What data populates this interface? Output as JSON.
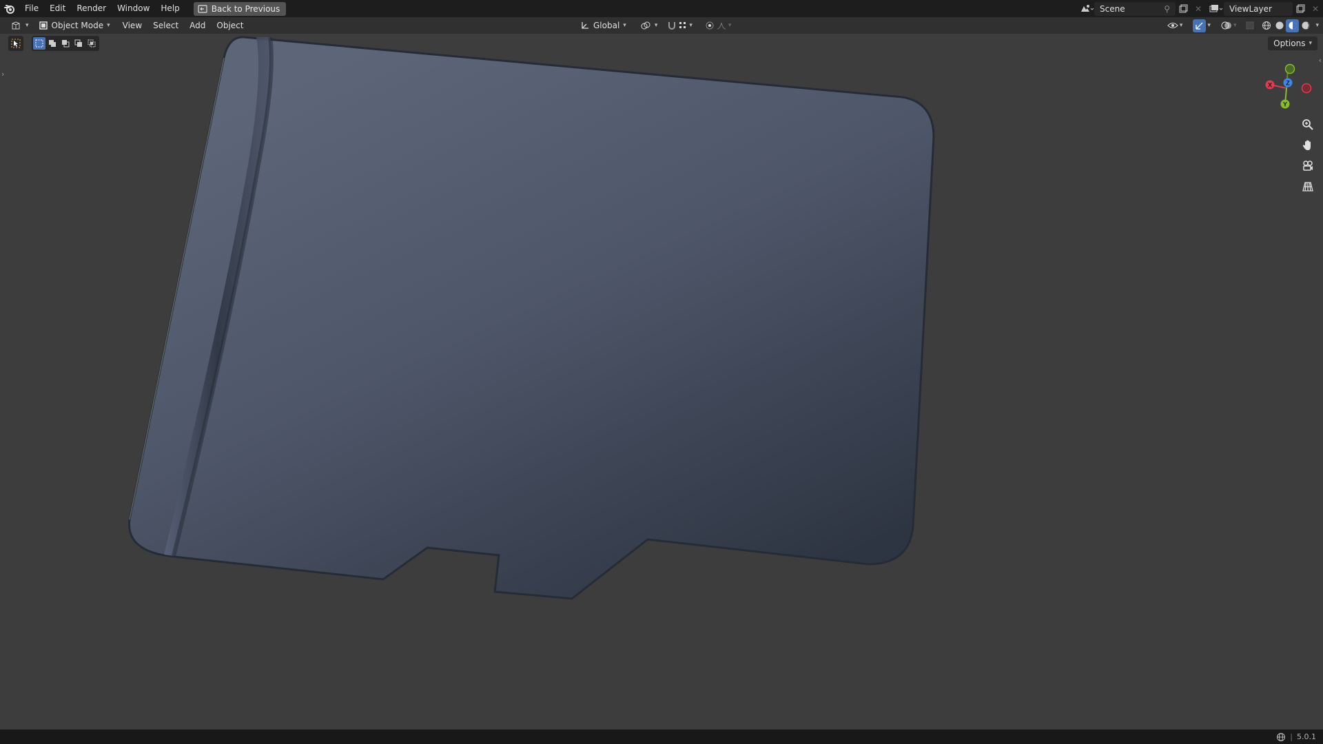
{
  "menu": {
    "items": [
      "File",
      "Edit",
      "Render",
      "Window",
      "Help"
    ],
    "back_button": "Back to Previous"
  },
  "topright": {
    "scene": "Scene",
    "view_layer": "ViewLayer"
  },
  "header": {
    "mode": "Object Mode",
    "menus": [
      "View",
      "Select",
      "Add",
      "Object"
    ],
    "orientation": "Global"
  },
  "viewport": {
    "options_label": "Options",
    "gizmo": {
      "x_label": "X",
      "y_label": "Y",
      "z_label": "Z"
    }
  },
  "statusbar": {
    "version": "5.0.1"
  },
  "colors": {
    "accent": "#4772b3",
    "x_axis": "#e23a4f",
    "y_axis": "#86bd2e",
    "z_axis": "#3f88e8",
    "model_top": "#5a6276",
    "model_bottom": "#2f3744"
  }
}
